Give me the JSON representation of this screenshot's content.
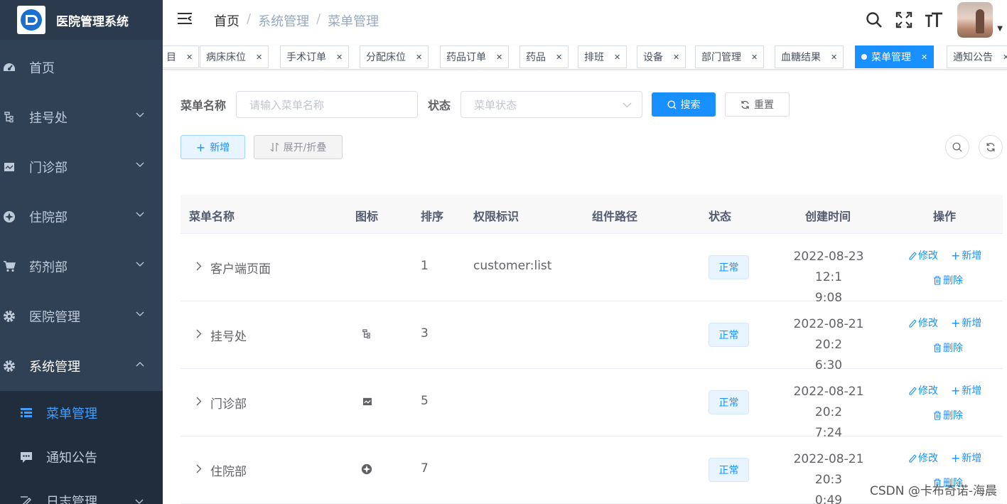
{
  "app": {
    "title": "医院管理系统"
  },
  "sidebar": {
    "items": [
      {
        "label": "首页",
        "icon": "dashboard-icon"
      },
      {
        "label": "挂号处",
        "icon": "tree-icon"
      },
      {
        "label": "门诊部",
        "icon": "monitor-icon"
      },
      {
        "label": "住院部",
        "icon": "guide-icon"
      },
      {
        "label": "药剂部",
        "icon": "cart-icon"
      },
      {
        "label": "医院管理",
        "icon": "gear-icon"
      },
      {
        "label": "系统管理",
        "icon": "gear-icon"
      }
    ],
    "sub_items": [
      {
        "label": "菜单管理",
        "icon": "tree-table-icon",
        "active": true
      },
      {
        "label": "通知公告",
        "icon": "message-icon"
      },
      {
        "label": "日志管理",
        "icon": "log-icon"
      }
    ]
  },
  "breadcrumb": {
    "home": "首页",
    "level1": "系统管理",
    "level2": "菜单管理",
    "sep": "/"
  },
  "tags": [
    {
      "label": "目",
      "active": false
    },
    {
      "label": "病床床位",
      "active": false
    },
    {
      "label": "手术订单",
      "active": false
    },
    {
      "label": "分配床位",
      "active": false
    },
    {
      "label": "药品订单",
      "active": false
    },
    {
      "label": "药品",
      "active": false
    },
    {
      "label": "排班",
      "active": false
    },
    {
      "label": "设备",
      "active": false
    },
    {
      "label": "部门管理",
      "active": false
    },
    {
      "label": "血糖结果",
      "active": false
    },
    {
      "label": "菜单管理",
      "active": true
    },
    {
      "label": "通知公告",
      "active": false
    }
  ],
  "search": {
    "name_label": "菜单名称",
    "name_placeholder": "请输入菜单名称",
    "status_label": "状态",
    "status_placeholder": "菜单状态",
    "search_button": "搜索",
    "reset_button": "重置"
  },
  "toolbar": {
    "add_button": "新增",
    "expand_button": "展开/折叠"
  },
  "table": {
    "columns": [
      "菜单名称",
      "图标",
      "排序",
      "权限标识",
      "组件路径",
      "状态",
      "创建时间",
      "操作"
    ],
    "rows": [
      {
        "name": "客户端页面",
        "icon": "",
        "order": "1",
        "perms": "customer:list",
        "component": "",
        "status": "正常",
        "time_line1": "2022-08-23 12:1",
        "time_line2": "9:08"
      },
      {
        "name": "挂号处",
        "icon": "tree-icon",
        "order": "3",
        "perms": "",
        "component": "",
        "status": "正常",
        "time_line1": "2022-08-21 20:2",
        "time_line2": "6:30"
      },
      {
        "name": "门诊部",
        "icon": "monitor-icon",
        "order": "5",
        "perms": "",
        "component": "",
        "status": "正常",
        "time_line1": "2022-08-21 20:2",
        "time_line2": "7:24"
      },
      {
        "name": "住院部",
        "icon": "guide-icon",
        "order": "7",
        "perms": "",
        "component": "",
        "status": "正常",
        "time_line1": "2022-08-21 20:3",
        "time_line2": "0:49"
      }
    ],
    "actions": {
      "edit": "修改",
      "add": "新增",
      "delete": "删除"
    }
  },
  "watermark": "CSDN @卡布奇诺-海晨",
  "colors": {
    "sidebar_bg": "#304156",
    "accent": "#1890ff",
    "active_menu": "#409eff"
  }
}
